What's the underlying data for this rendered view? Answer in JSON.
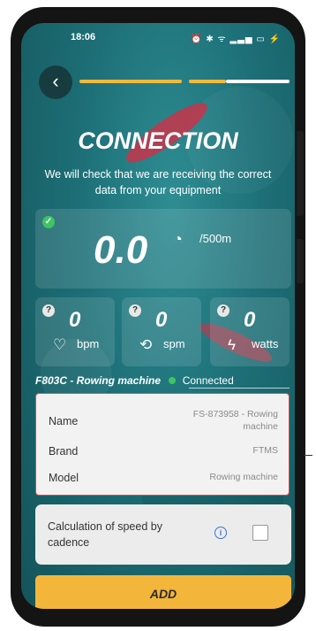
{
  "status_bar": {
    "time": "18:06",
    "icons": "⏰ ✱ ᯤ ▂▃▅ ▭ ⚡"
  },
  "header": {
    "back_icon": "chevron-left-icon"
  },
  "progress_steps": [
    {
      "state": "done"
    },
    {
      "state": "done"
    },
    {
      "state": "current"
    }
  ],
  "title": "CONNECTION",
  "subtitle": "We will check that we are receiving the correct data from your equipment",
  "pace": {
    "value": "0.0",
    "unit": "/500m",
    "status": "check"
  },
  "metrics": [
    {
      "value": "0",
      "unit": "bpm",
      "icon": "heart-icon"
    },
    {
      "value": "0",
      "unit": "spm",
      "icon": "refresh-icon"
    },
    {
      "value": "0",
      "unit": "watts",
      "icon": "lightning-icon"
    }
  ],
  "device": {
    "name": "F803C - Rowing machine",
    "status": "Connected"
  },
  "details": {
    "name_label": "Name",
    "name_value": "FS-873958 - Rowing machine",
    "brand_label": "Brand",
    "brand_value": "FTMS",
    "model_label": "Model",
    "model_value": "Rowing machine"
  },
  "speed_option": {
    "label": "Calculation of speed by cadence",
    "checked": false
  },
  "add_button": "ADD",
  "colors": {
    "accent": "#f3b63a",
    "connected": "#3ec463",
    "highlight_border": "#d94b4b"
  }
}
